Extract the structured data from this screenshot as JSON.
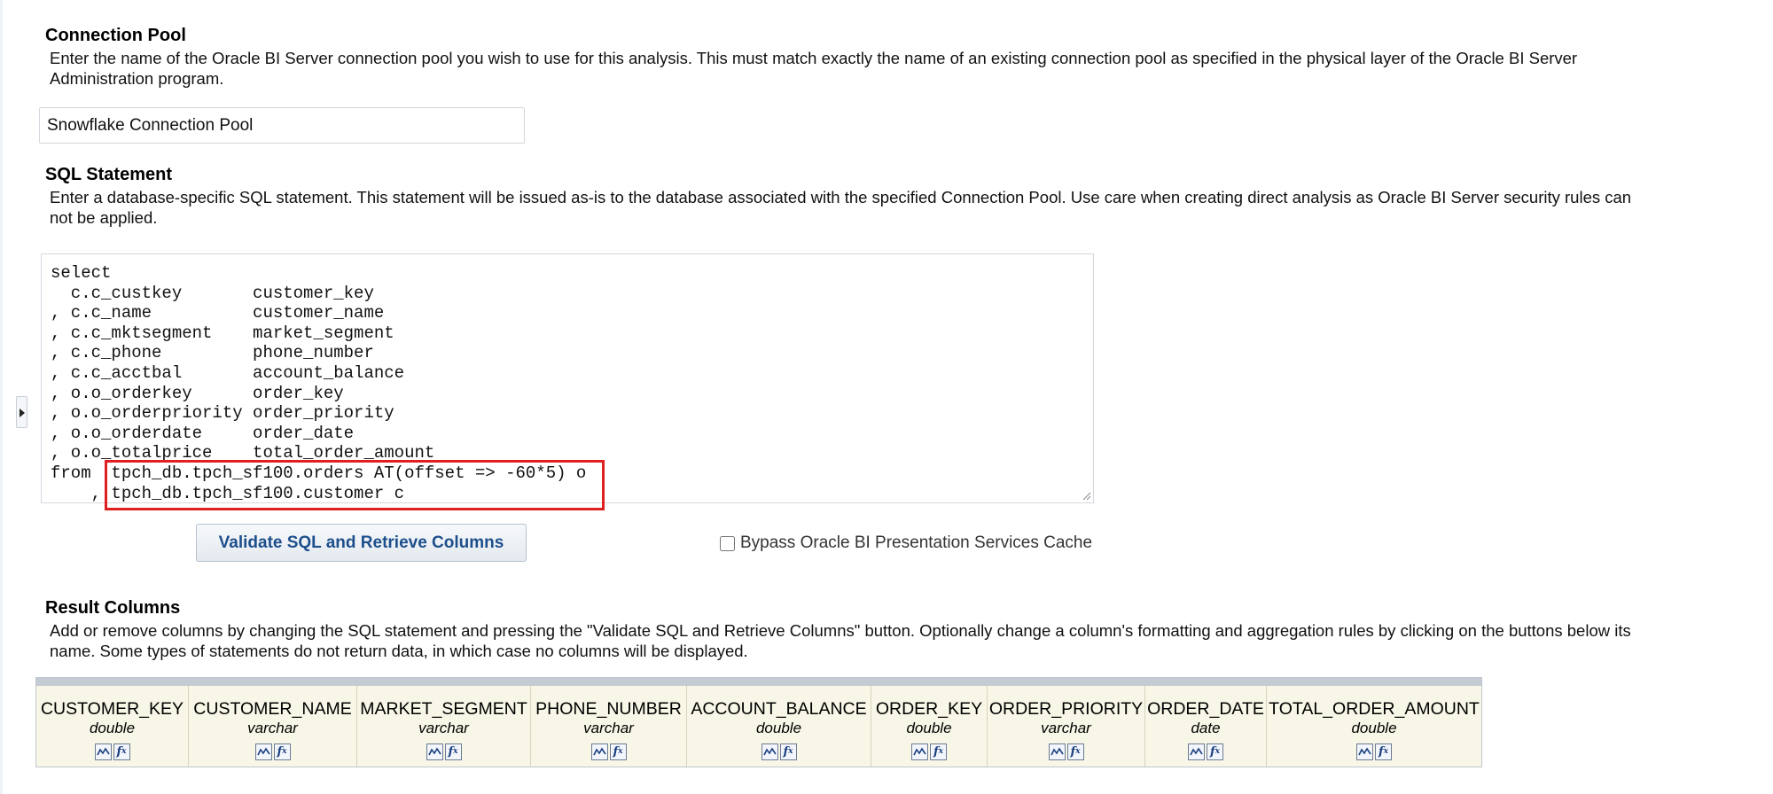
{
  "connection_pool": {
    "title": "Connection Pool",
    "description_line1": "Enter the name of the Oracle BI Server connection pool you wish to use for this analysis. This must match exactly the name of an existing connection pool as specified in the physical layer of the Oracle BI Server",
    "description_line2": "Administration program.",
    "value": "Snowflake Connection Pool"
  },
  "sql_statement": {
    "title": "SQL Statement",
    "description_line1": "Enter a database-specific SQL statement. This statement will be issued as-is to the database associated with the specified Connection Pool. Use care when creating direct analysis as Oracle BI Server security rules can",
    "description_line2": "not be applied.",
    "sql": "select\n  c.c_custkey       customer_key\n, c.c_name          customer_name\n, c.c_mktsegment    market_segment\n, c.c_phone         phone_number\n, c.c_acctbal       account_balance\n, o.o_orderkey      order_key\n, o.o_orderpriority order_priority\n, o.o_orderdate     order_date\n, o.o_totalprice    total_order_amount\nfrom  tpch_db.tpch_sf100.orders AT(offset => -60*5) o\n    , tpch_db.tpch_sf100.customer c"
  },
  "actions": {
    "validate_label": "Validate SQL and Retrieve Columns",
    "bypass_cache_label": "Bypass Oracle BI Presentation Services Cache",
    "bypass_cache_checked": false
  },
  "result_columns": {
    "title": "Result Columns",
    "description_line1": "Add or remove columns by changing the SQL statement and pressing the \"Validate SQL and Retrieve Columns\" button. Optionally change a column's formatting and aggregation rules by clicking on the buttons below its",
    "description_line2": "name. Some types of statements do not return data, in which case no columns will be displayed.",
    "columns": [
      {
        "name": "CUSTOMER_KEY",
        "type": "double"
      },
      {
        "name": "CUSTOMER_NAME",
        "type": "varchar"
      },
      {
        "name": "MARKET_SEGMENT",
        "type": "varchar"
      },
      {
        "name": "PHONE_NUMBER",
        "type": "varchar"
      },
      {
        "name": "ACCOUNT_BALANCE",
        "type": "double"
      },
      {
        "name": "ORDER_KEY",
        "type": "double"
      },
      {
        "name": "ORDER_PRIORITY",
        "type": "varchar"
      },
      {
        "name": "ORDER_DATE",
        "type": "date"
      },
      {
        "name": "TOTAL_ORDER_AMOUNT",
        "type": "double"
      }
    ],
    "column_icons": [
      "column-format-icon",
      "column-formula-icon"
    ]
  },
  "colors": {
    "highlight": "#e02020",
    "button_text": "#1d4f8c",
    "column_header_bg": "#f8f6e6"
  }
}
